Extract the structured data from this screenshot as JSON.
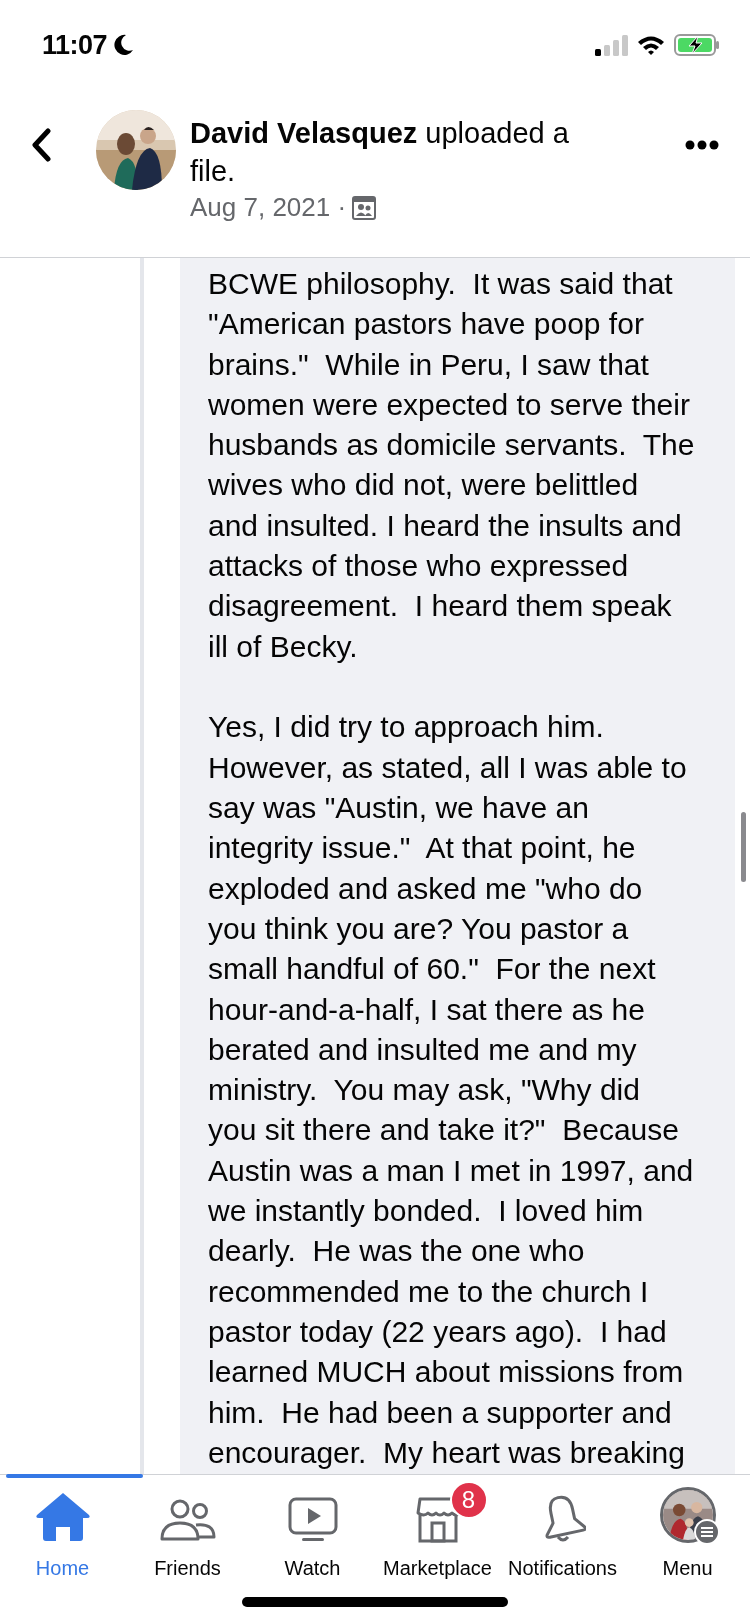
{
  "status_bar": {
    "time": "11:07"
  },
  "post_header": {
    "author_line": "**David Velasquez** uploaded a file.",
    "date": "Aug 7, 2021 ·"
  },
  "document": {
    "paragraphs": [
      {
        "lines": [
          "BCWE philosophy.  It was said that",
          "\"American pastors have poop for",
          "brains.\"  While in Peru, I saw that",
          "women were expected to serve their",
          "husbands as domicile servants.  The",
          "wives who did not, were belittled",
          "and insulted. I heard the insults and",
          "attacks of those who expressed",
          "disagreement.  I heard them speak",
          "ill of Becky."
        ]
      },
      {
        "lines": [
          "Yes, I did try to approach him.",
          "However, as stated, all I was able to",
          "say was \"Austin, we have an",
          "integrity issue.\"  At that point, he",
          "exploded and asked me \"who do",
          "you think you are? You pastor a",
          "small handful of 60.\"  For the next",
          "hour-and-a-half, I sat there as he",
          "berated and insulted me and my",
          "ministry.  You may ask, \"Why did",
          "you sit there and take it?\"  Because",
          "Austin was a man I met in 1997, and",
          "we instantly bonded.  I loved him",
          "dearly.  He was the one who",
          "recommended me to the church I",
          "pastor today (22 years ago).  I had",
          "learned MUCH about missions from",
          "him.  He had been a supporter and",
          "encourager.  My heart was breaking"
        ]
      }
    ]
  },
  "tab_bar": {
    "tabs": [
      {
        "kind": "home",
        "label": "Home",
        "selected": true
      },
      {
        "kind": "friends",
        "label": "Friends",
        "selected": false
      },
      {
        "kind": "watch",
        "label": "Watch",
        "selected": false
      },
      {
        "kind": "marketplace",
        "label": "Marketplace",
        "selected": false,
        "badge": "8"
      },
      {
        "kind": "notifications",
        "label": "Notifications",
        "selected": false
      },
      {
        "kind": "menu",
        "label": "Menu",
        "selected": false
      }
    ]
  }
}
